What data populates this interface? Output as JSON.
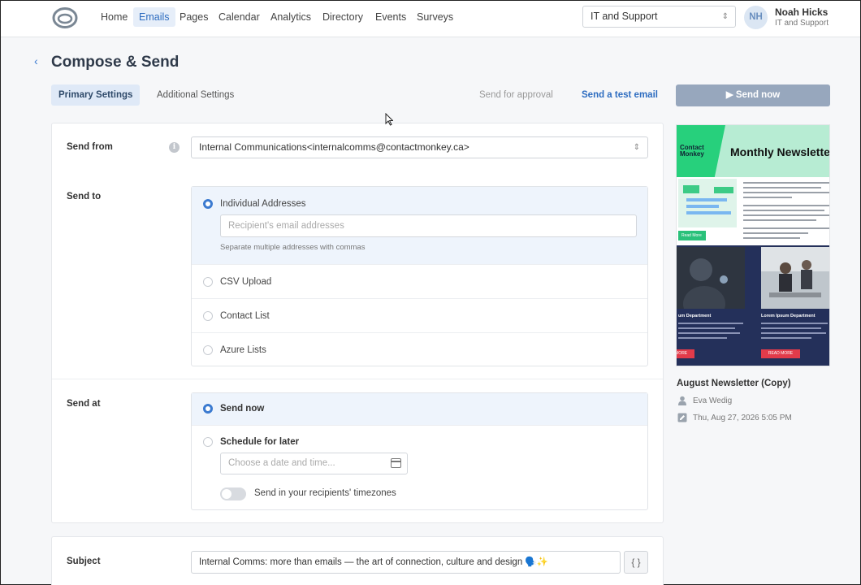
{
  "nav": {
    "items": [
      "Home",
      "Emails",
      "Pages",
      "Calendar",
      "Analytics",
      "Directory",
      "Events",
      "Surveys"
    ],
    "active": "Emails",
    "org_select": "IT and Support",
    "user": {
      "initials": "NH",
      "name": "Noah Hicks",
      "org": "IT and Support"
    }
  },
  "header": {
    "back_icon": "chevron-left-icon",
    "title": "Compose & Send",
    "tabs": [
      "Primary Settings",
      "Additional Settings"
    ],
    "active_tab": "Primary Settings",
    "send_for_approval": "Send for approval",
    "send_test": "Send a test email",
    "send_now": "Send now"
  },
  "form": {
    "send_from": {
      "label": "Send from",
      "value": "Internal Communications<internalcomms@contactmonkey.ca>"
    },
    "send_to": {
      "label": "Send to",
      "options": [
        "Individual Addresses",
        "CSV Upload",
        "Contact List",
        "Azure Lists"
      ],
      "selected": "Individual Addresses",
      "email_placeholder": "Recipient's email addresses",
      "hint": "Separate multiple addresses with commas"
    },
    "send_at": {
      "label": "Send at",
      "options": [
        "Send now",
        "Schedule for later"
      ],
      "selected": "Send now",
      "date_placeholder": "Choose a date and time...",
      "timezone_toggle": "Send in your recipients' timezones",
      "timezone_on": false
    },
    "subject": {
      "label": "Subject",
      "value": "Internal Comms: more than emails — the art of connection, culture and design 🗣️✨",
      "variables_button": "{ }"
    }
  },
  "preview": {
    "brand": "Contact Monkey",
    "title": "Monthly Newsletter",
    "read_more": "Read More",
    "dept_left": "um Department",
    "dept_right": "Lorem Ipsum Department",
    "cta": "READ MORE",
    "newsletter_name": "August Newsletter (Copy)",
    "author": "Eva Wedig",
    "date": "Thu, Aug 27, 2026 5:05 PM",
    "colors": {
      "green": "#27d07c",
      "mint": "#b7ecd3",
      "navy": "#24305a",
      "red": "#e33b4a"
    }
  },
  "colors": {
    "accent": "#3b7ad0",
    "send_button": "#97a7bd"
  }
}
